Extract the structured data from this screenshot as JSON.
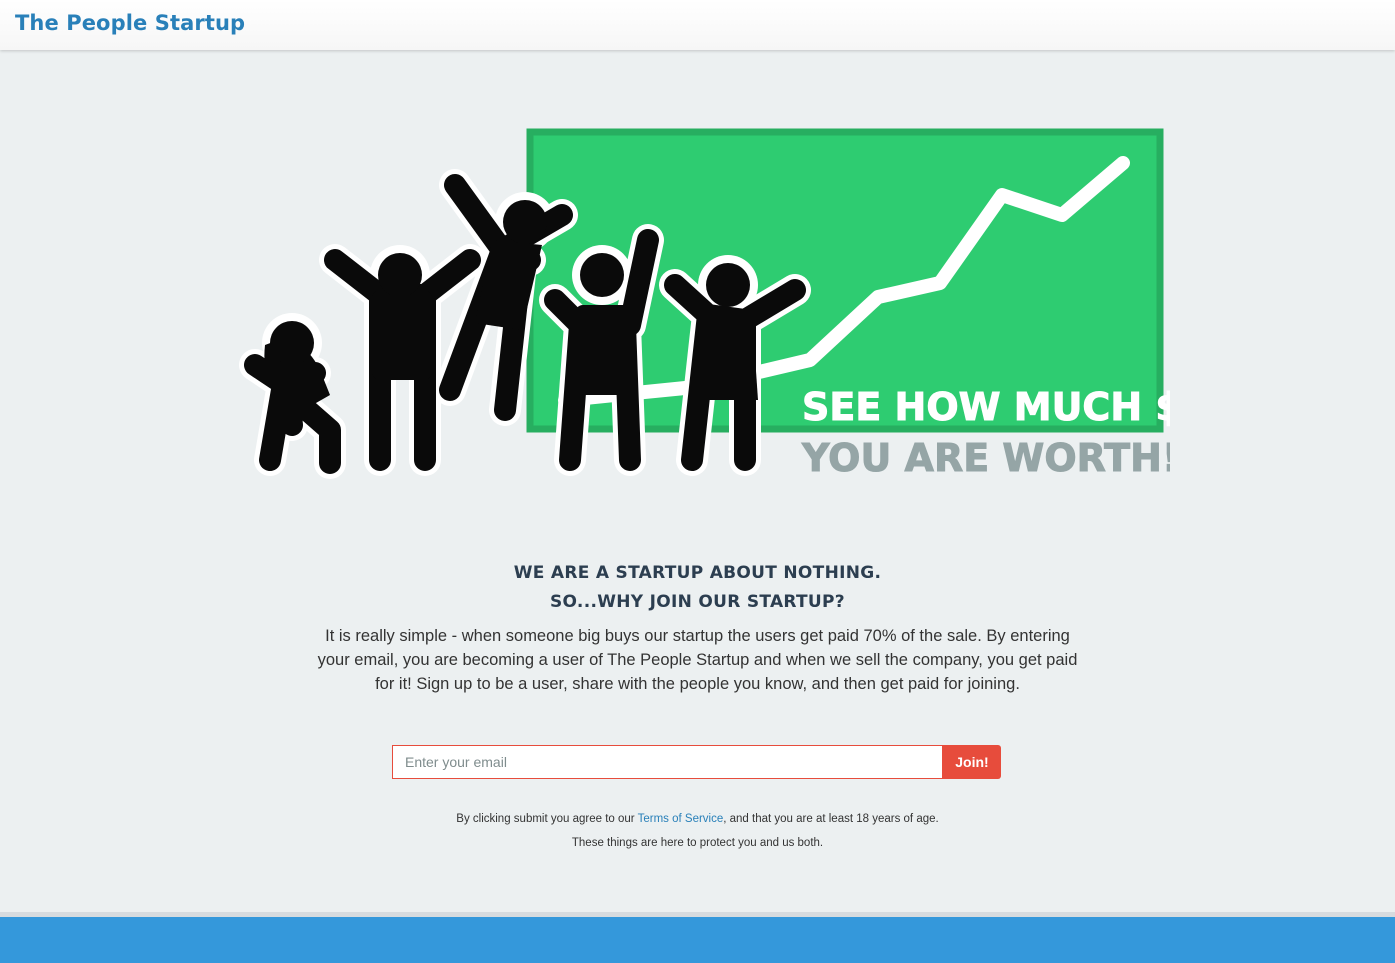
{
  "navbar": {
    "brand": "The People Startup"
  },
  "hero": {
    "banner_line1": "SEE HOW MUCH $",
    "banner_line2": "YOU ARE WORTH!",
    "colors": {
      "board": "#2ecc71",
      "board_border": "#27ae60",
      "trend_line": "#ffffff",
      "figures": "#0a0a0a",
      "line2": "#95a5a6"
    }
  },
  "main": {
    "headline1": "WE ARE A STARTUP ABOUT NOTHING.",
    "headline2": "SO...WHY JOIN OUR STARTUP?",
    "description": "It is really simple - when someone big buys our startup the users get paid 70% of the sale. By entering your email, you are becoming a user of The People Startup and when we sell the company, you get paid for it! Sign up to be a user, share with the people you know, and then get paid for joining."
  },
  "signup": {
    "email_placeholder": "Enter your email",
    "email_value": "",
    "join_label": "Join!",
    "accent": "#e74c3c"
  },
  "terms": {
    "prefix": "By clicking submit you agree to our ",
    "link": "Terms of Service",
    "suffix": ", and that you are at least 18 years of age.",
    "line2": "These things are here to protect you and us both."
  },
  "footer": {
    "color": "#3498db"
  }
}
